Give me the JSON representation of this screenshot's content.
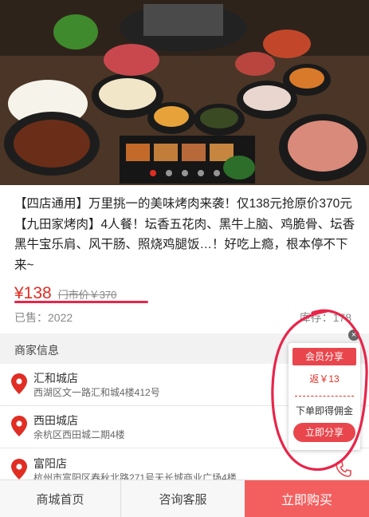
{
  "hero": {
    "carousel_dots": 5,
    "active_index": 0
  },
  "description": "【四店通用】万里挑一的美味烤肉来袭！仅138元抢原价370元【九田家烤肉】4人餐！坛香五花肉、黑牛上脑、鸡脆骨、坛香黑牛宝乐肩、风干肠、照烧鸡腿饭…！好吃上瘾，根本停不下来~",
  "price": {
    "current": "¥138",
    "market": "门市价￥370"
  },
  "sold": "已售：2022",
  "stock": "库存：178",
  "merchant_section": {
    "title": "商家信息"
  },
  "stores": [
    {
      "name": "汇和城店",
      "address": "西湖区文一路汇和城4楼412号"
    },
    {
      "name": "西田城店",
      "address": "余杭区西田城二期4楼"
    },
    {
      "name": "富阳店",
      "address": "杭州市富阳区春秋北路271号天长城商业广场4楼"
    }
  ],
  "share_popup": {
    "close_label": "×",
    "title": "会员分享",
    "rebate": "返￥13",
    "commission": "下单即得佣金",
    "button": "立即分享"
  },
  "bottom_bar": {
    "home": "商城首页",
    "service": "咨询客服",
    "buy": "立即购买"
  },
  "colors": {
    "accent": "#e02e24",
    "buy_button": "#f35f5f",
    "annotation": "#e8254a"
  }
}
